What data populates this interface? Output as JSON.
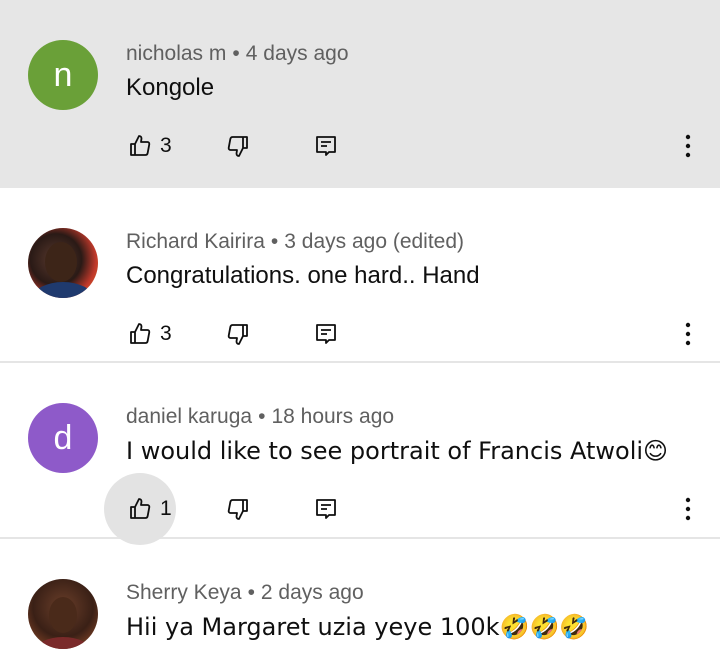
{
  "comments": [
    {
      "avatar_letter": "n",
      "avatar_color": "#6aa038",
      "author": "nicholas m",
      "separator": "•",
      "time": "4 days ago",
      "text": "Kongole",
      "likes": "3",
      "highlighted": true
    },
    {
      "avatar_letter": "",
      "avatar_color": "#3a2a2a",
      "author": "Richard Kairira",
      "separator": "•",
      "time": "3 days ago (edited)",
      "text": "Congratulations. one hard.. Hand",
      "likes": "3"
    },
    {
      "avatar_letter": "d",
      "avatar_color": "#8e5ac9",
      "author": "daniel karuga",
      "separator": "•",
      "time": "18 hours ago",
      "text": "I would like to see portrait of Francis Atwoli😊",
      "likes": "1"
    },
    {
      "avatar_letter": "",
      "avatar_color": "#5a3a2a",
      "author": "Sherry Keya",
      "separator": "•",
      "time": "2 days ago",
      "text": "Hii ya Margaret uzia yeye 100k🤣🤣🤣"
    }
  ]
}
